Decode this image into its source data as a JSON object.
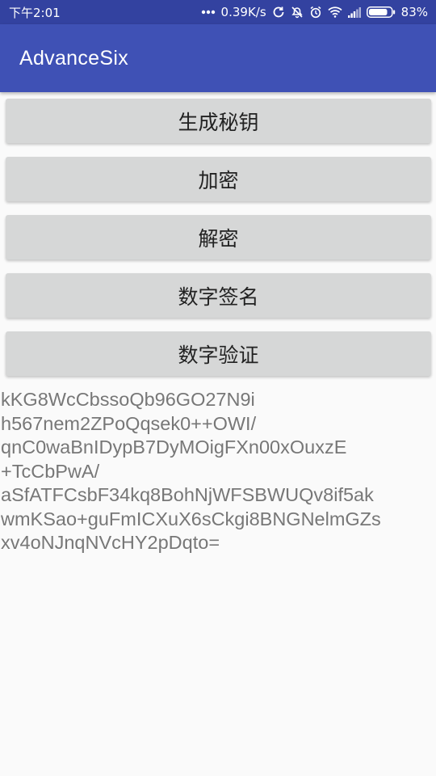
{
  "status_bar": {
    "time": "下午2:01",
    "network_speed": "0.39K/s",
    "battery": "83%",
    "icons": [
      "more-dots-icon",
      "sync-icon",
      "silent-icon",
      "alarm-icon",
      "wifi-icon",
      "signal-icon",
      "battery-icon"
    ],
    "battery_level": 0.83
  },
  "app_bar": {
    "title": "AdvanceSix",
    "color": "#3f51b5",
    "status_color": "#3342a0"
  },
  "buttons": [
    {
      "label": "生成秘钥"
    },
    {
      "label": "加密"
    },
    {
      "label": "解密"
    },
    {
      "label": "数字签名"
    },
    {
      "label": "数字验证"
    }
  ],
  "output_lines": [
    "kKG8WcCbssoQb96GO27N9i",
    "h567nem2ZPoQqsek0++OWI/",
    "qnC0waBnIDypB7DyMOigFXn00xOuxzE",
    "+TcCbPwA/",
    "aSfATFCsbF34kq8BohNjWFSBWUQv8if5ak",
    "wmKSao+guFmICXuX6sCkgi8BNGNelmGZs",
    "xv4oNJnqNVcHY2pDqto="
  ]
}
